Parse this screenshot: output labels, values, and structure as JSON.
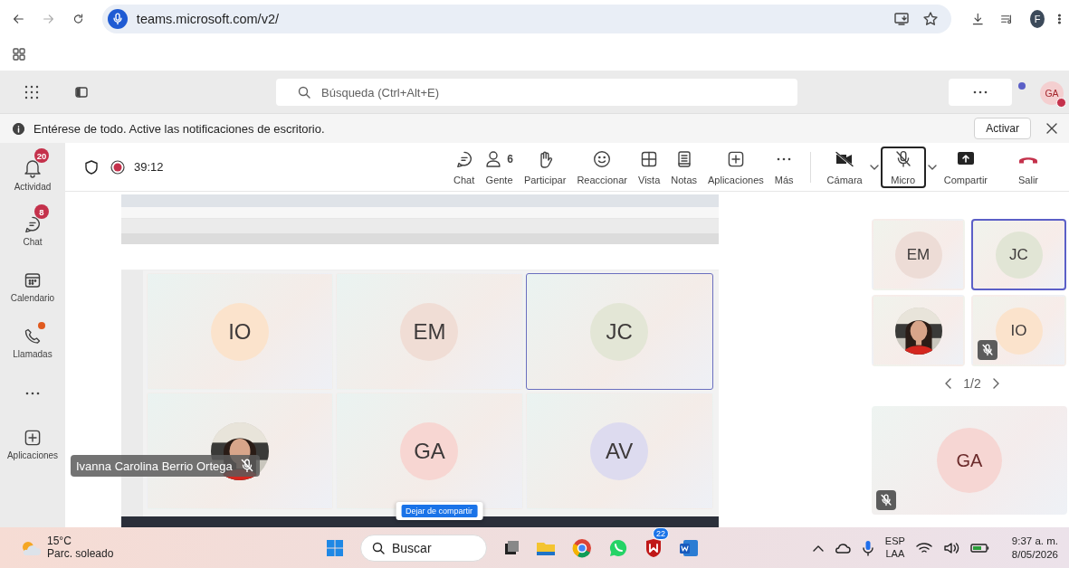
{
  "browser": {
    "url": "teams.microsoft.com/v2/",
    "profile": "F"
  },
  "header": {
    "search_placeholder": "Búsqueda (Ctrl+Alt+E)",
    "avatar": "GA"
  },
  "notification": {
    "text": "Entérese de todo. Active las notificaciones de escritorio.",
    "button": "Activar"
  },
  "rail": [
    {
      "kind": "activity",
      "label": "Actividad",
      "badge": "20",
      "alert": false
    },
    {
      "kind": "chat",
      "label": "Chat",
      "badge": "8",
      "alert": false
    },
    {
      "kind": "calendar",
      "label": "Calendario",
      "alert": false
    },
    {
      "kind": "calls",
      "label": "Llamadas",
      "alert": true
    },
    {
      "kind": "more"
    },
    {
      "kind": "apps",
      "label": "Aplicaciones",
      "alert": false
    }
  ],
  "meeting": {
    "timer": "39:12",
    "recording": true,
    "controls": [
      {
        "kind": "chat",
        "label": "Chat"
      },
      {
        "kind": "people",
        "label": "Gente",
        "count": "6"
      },
      {
        "kind": "hand",
        "label": "Participar"
      },
      {
        "kind": "smile",
        "label": "Reaccionar"
      },
      {
        "kind": "grid",
        "label": "Vista"
      },
      {
        "kind": "notes",
        "label": "Notas"
      },
      {
        "kind": "apps",
        "label": "Aplicaciones"
      },
      {
        "kind": "more",
        "label": "Más"
      }
    ],
    "devices": [
      {
        "kind": "camera-off",
        "label": "Cámara",
        "dropdown": true,
        "selected": false
      },
      {
        "kind": "mic-off",
        "label": "Micro",
        "dropdown": true,
        "selected": true
      },
      {
        "kind": "share",
        "label": "Compartir",
        "dropdown": false,
        "selected": false
      },
      {
        "kind": "leave",
        "label": "Salir",
        "dropdown": false,
        "selected": false
      }
    ]
  },
  "shared_screen": {
    "tiles": [
      {
        "kind": "initials",
        "text": "IO",
        "color": "#fbe3cc",
        "selected": false
      },
      {
        "kind": "initials",
        "text": "EM",
        "color": "#f0ddd5",
        "selected": false
      },
      {
        "kind": "initials",
        "text": "JC",
        "color": "#e3e6d6",
        "selected": true
      },
      {
        "kind": "picture",
        "selected": false
      },
      {
        "kind": "initials",
        "text": "GA",
        "color": "#f7d6d2",
        "selected": false
      },
      {
        "kind": "initials",
        "text": "AV",
        "color": "#dddbef",
        "selected": false
      }
    ],
    "stop_button": "Dejar de compartir"
  },
  "side_tiles": [
    {
      "kind": "initials",
      "text": "EM",
      "color": "#eddcd6",
      "selected": false,
      "muted": false
    },
    {
      "kind": "initials",
      "text": "JC",
      "color": "#e1e5d5",
      "selected": true,
      "muted": false
    },
    {
      "kind": "picture",
      "selected": false,
      "muted": false
    },
    {
      "kind": "initials",
      "text": "IO",
      "color": "#fbe3cc",
      "selected": false,
      "muted": true
    }
  ],
  "pager": "1/2",
  "main_tile": {
    "text": "GA",
    "color": "#f6d6d3",
    "muted": true
  },
  "presenter": {
    "name": "Ivanna Carolina Berrio Ortega",
    "muted": true
  },
  "taskbar": {
    "temperature": "15°C",
    "weather": "Parc. soleado",
    "search": "Buscar",
    "chat_badge": "22",
    "language": "ESP",
    "layout": "LAA",
    "time": "9:37 a. m.",
    "date": "8/05/2026"
  }
}
